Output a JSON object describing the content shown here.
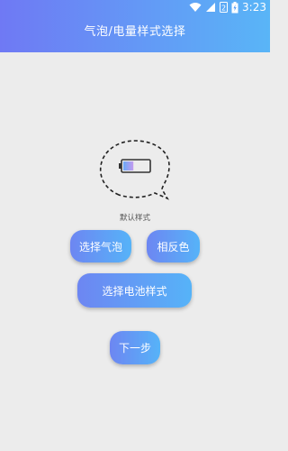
{
  "status_bar": {
    "time": "3:23",
    "icons": [
      "wifi-icon",
      "signal-icon",
      "sim-icon",
      "battery-charging-icon"
    ]
  },
  "header": {
    "title": "气泡/电量样式选择"
  },
  "preview": {
    "label": "默认样式",
    "battery_level": 0.4
  },
  "buttons": {
    "select_bubble": "选择气泡",
    "invert_color": "相反色",
    "select_battery_style": "选择电池样式",
    "next_step": "下一步"
  },
  "colors": {
    "header_gradient_start": "#6f79f4",
    "header_gradient_end": "#59b5f7",
    "button_gradient_start": "#6d86f2",
    "button_gradient_end": "#56b3f8",
    "background": "#ececec"
  }
}
